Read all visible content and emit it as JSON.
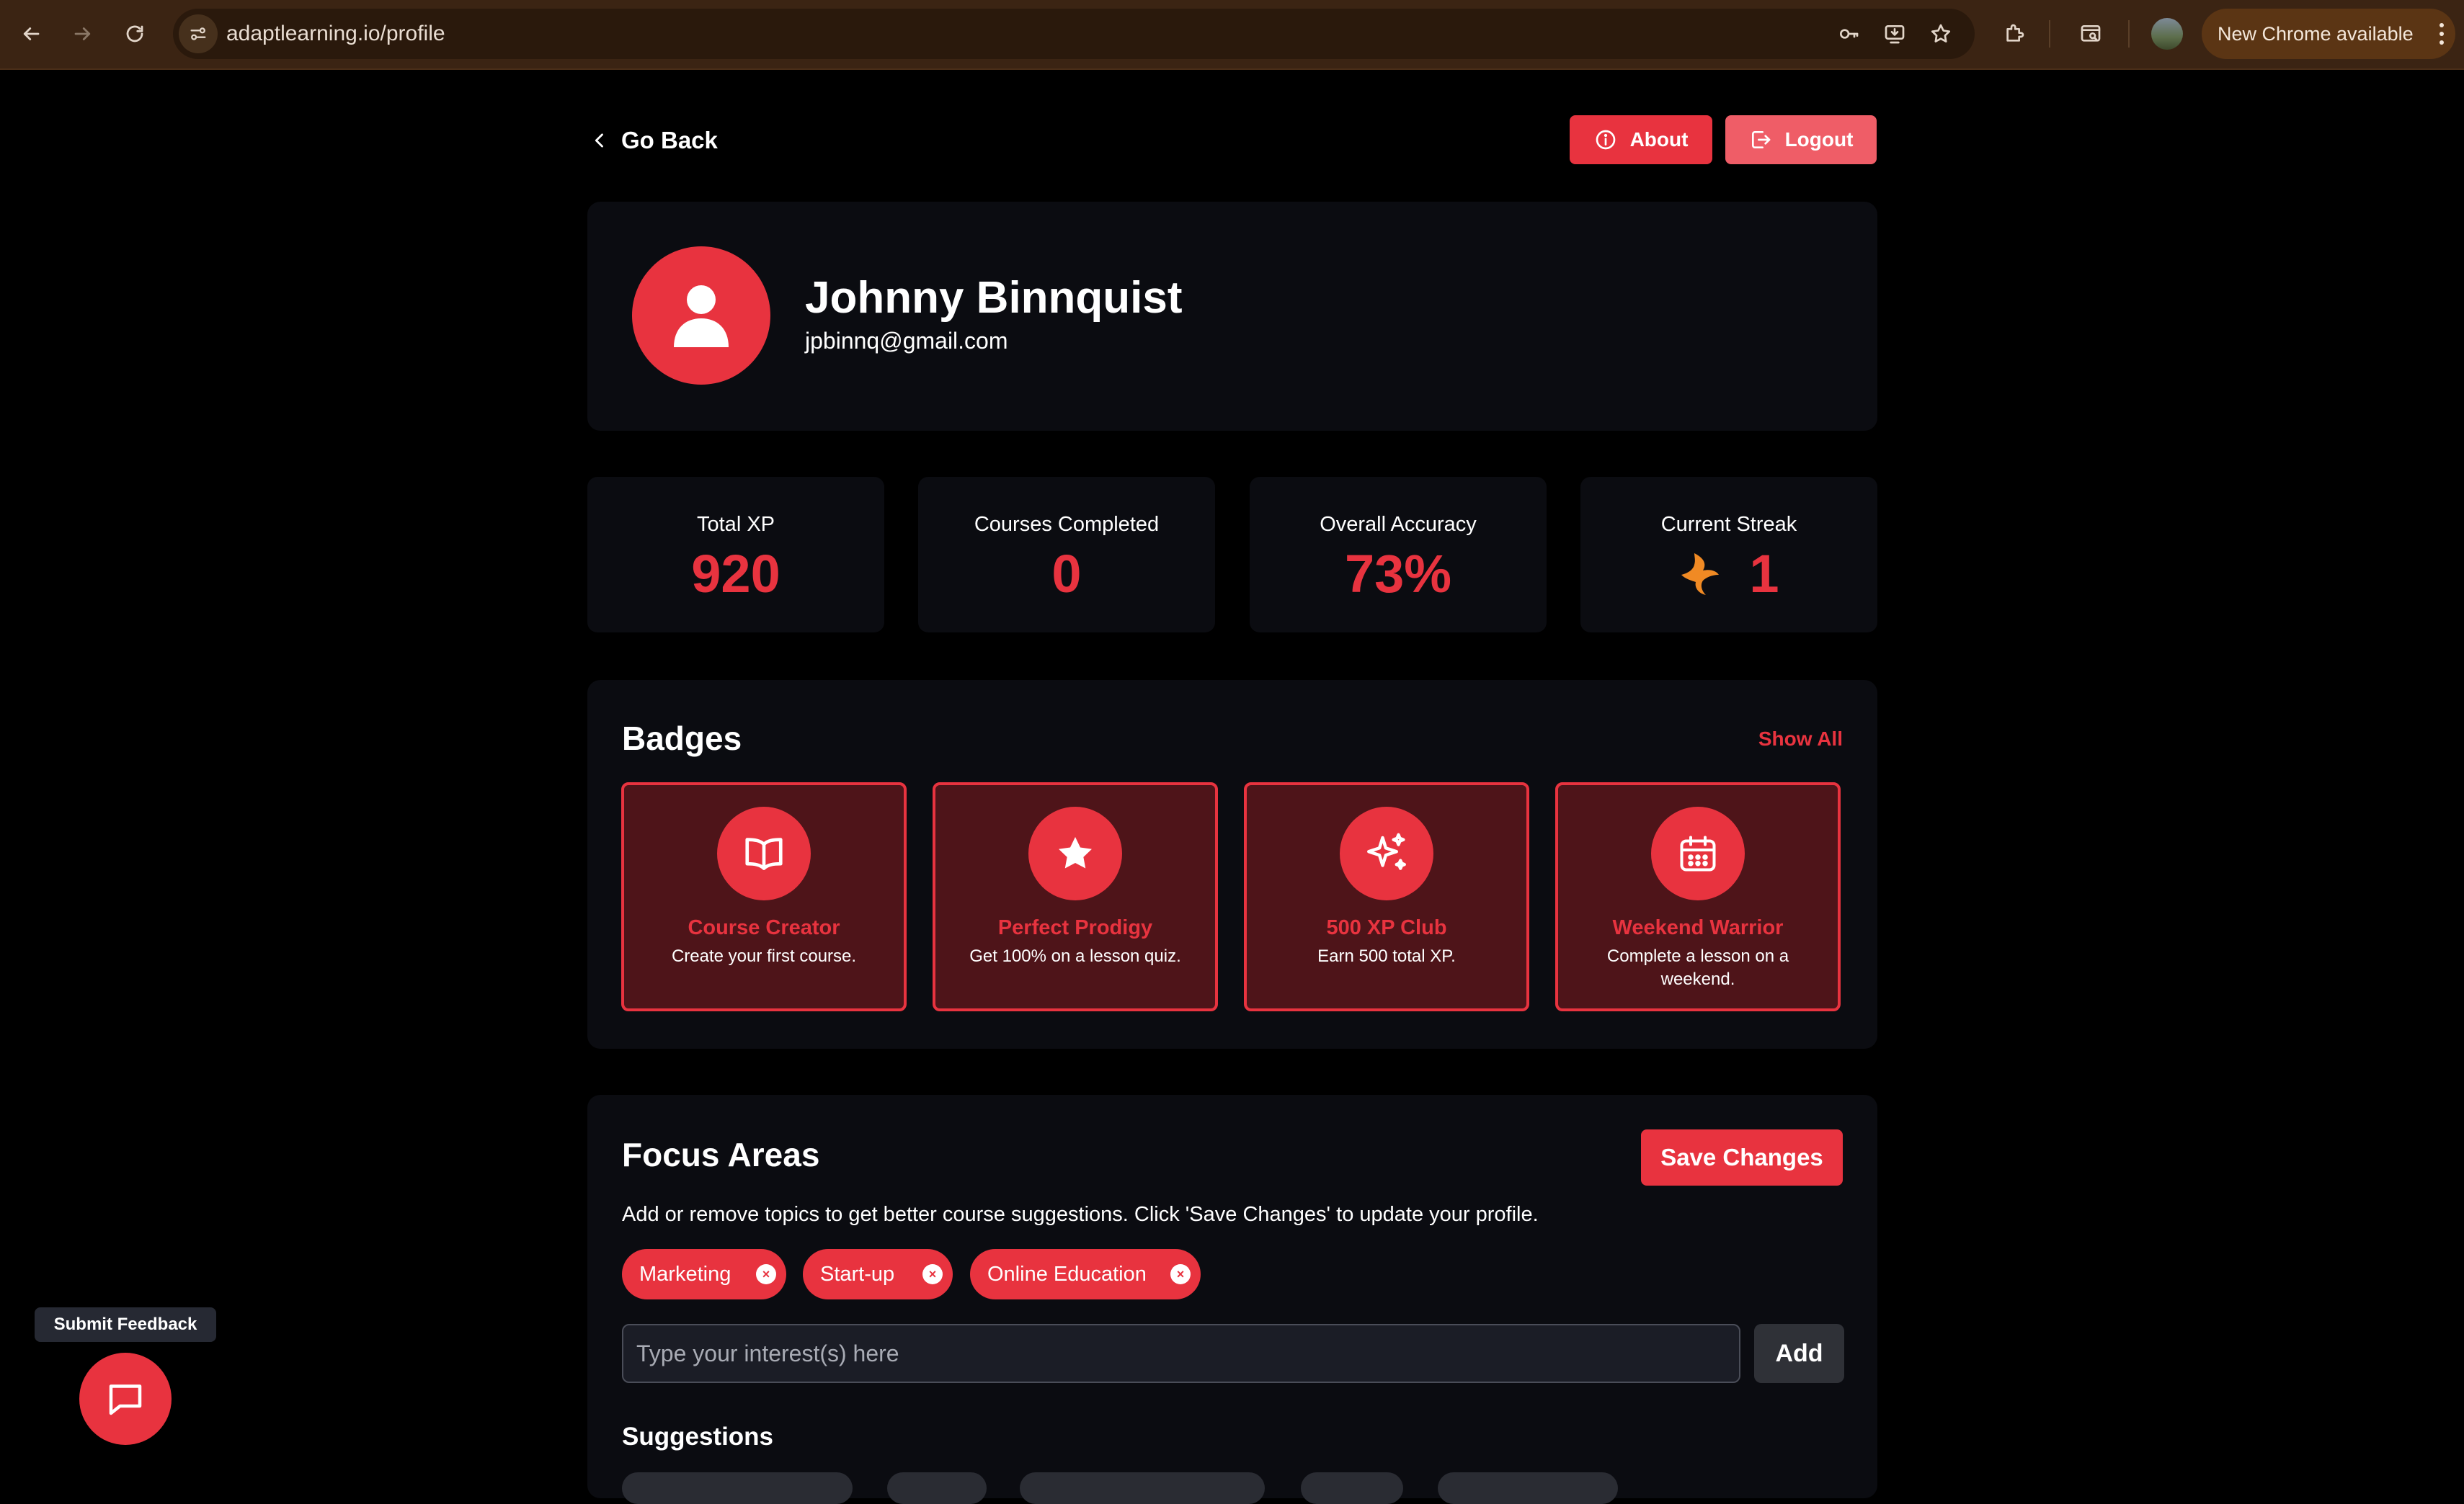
{
  "browser": {
    "url": "adaptlearning.io/profile",
    "update_label": "New Chrome available"
  },
  "header": {
    "back_label": "Go Back",
    "about_label": "About",
    "logout_label": "Logout"
  },
  "profile": {
    "name": "Johnny Binnquist",
    "email": "jpbinnq@gmail.com"
  },
  "stats": [
    {
      "label": "Total XP",
      "value": "920"
    },
    {
      "label": "Courses Completed",
      "value": "0"
    },
    {
      "label": "Overall Accuracy",
      "value": "73%"
    },
    {
      "label": "Current Streak",
      "value": "1",
      "icon": "flame-icon"
    }
  ],
  "badges": {
    "title": "Badges",
    "show_all_label": "Show All",
    "items": [
      {
        "title": "Course Creator",
        "description": "Create your first course.",
        "icon": "book-icon"
      },
      {
        "title": "Perfect Prodigy",
        "description": "Get 100% on a lesson quiz.",
        "icon": "star-icon"
      },
      {
        "title": "500 XP Club",
        "description": "Earn 500 total XP.",
        "icon": "sparkles-icon"
      },
      {
        "title": "Weekend Warrior",
        "description": "Complete a lesson on a weekend.",
        "icon": "calendar-icon"
      }
    ]
  },
  "focus": {
    "title": "Focus Areas",
    "save_label": "Save Changes",
    "description": "Add or remove topics to get better course suggestions. Click 'Save Changes' to update your profile.",
    "chips": [
      "Marketing",
      "Start-up",
      "Online Education"
    ],
    "chip_remove_glyph": "×",
    "input_placeholder": "Type your interest(s) here",
    "add_label": "Add",
    "suggestions_title": "Suggestions"
  },
  "feedback": {
    "tooltip": "Submit Feedback"
  },
  "colors": {
    "accent": "#e8333f",
    "card_bg": "#0b0c11",
    "badge_bg": "#4e1419",
    "chrome_bg": "#3b2413",
    "streak_flame": "#f08a24"
  }
}
